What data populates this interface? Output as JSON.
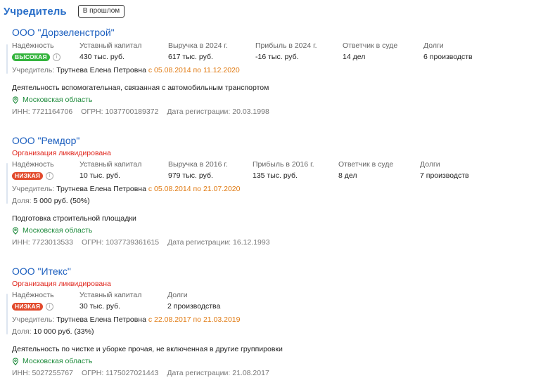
{
  "section": {
    "title": "Учредитель",
    "past_button": "В прошлом"
  },
  "companies": [
    {
      "name": "ООО \"Дорзеленстрой\"",
      "status": "",
      "stats": {
        "reliability_label": "Надёжность",
        "reliability_value": "ВЫСОКАЯ",
        "reliability_color": "#34b43d",
        "capital_label": "Уставный капитал",
        "capital_value": "430 тыс. руб.",
        "revenue_label": "Выручка в 2024 г.",
        "revenue_value": "617 тыс. руб.",
        "profit_label": "Прибыль в 2024 г.",
        "profit_value": "-16 тыс. руб.",
        "court_label": "Ответчик в суде",
        "court_value": "14 дел",
        "debts_label": "Долги",
        "debts_value": "6 производств"
      },
      "founder_label": "Учредитель:",
      "founder_name": "Трутнева Елена Петровна",
      "founder_period": "с 05.08.2014 по 11.12.2020",
      "share_label": "",
      "share_value": "",
      "activity": "Деятельность вспомогательная, связанная с автомобильным транспортом",
      "region": "Московская область",
      "inn": "ИНН: 7721164706",
      "ogrn": "ОГРН: 1037700189372",
      "reg_date": "Дата регистрации: 20.03.1998"
    },
    {
      "name": "ООО \"Ремдор\"",
      "status": "Организация ликвидирована",
      "stats": {
        "reliability_label": "Надёжность",
        "reliability_value": "НИЗКАЯ",
        "reliability_color": "#e24a2c",
        "capital_label": "Уставный капитал",
        "capital_value": "10 тыс. руб.",
        "revenue_label": "Выручка в 2016 г.",
        "revenue_value": "979 тыс. руб.",
        "profit_label": "Прибыль в 2016 г.",
        "profit_value": "135 тыс. руб.",
        "court_label": "Ответчик в суде",
        "court_value": "8 дел",
        "debts_label": "Долги",
        "debts_value": "7 производств"
      },
      "founder_label": "Учредитель:",
      "founder_name": "Трутнева Елена Петровна",
      "founder_period": "с 05.08.2014 по 21.07.2020",
      "share_label": "Доля:",
      "share_value": "5 000 руб. (50%)",
      "activity": "Подготовка строительной площадки",
      "region": "Московская область",
      "inn": "ИНН: 7723013533",
      "ogrn": "ОГРН: 1037739361615",
      "reg_date": "Дата регистрации: 16.12.1993"
    },
    {
      "name": "ООО \"Итекс\"",
      "status": "Организация ликвидирована",
      "stats": {
        "reliability_label": "Надёжность",
        "reliability_value": "НИЗКАЯ",
        "reliability_color": "#e24a2c",
        "capital_label": "Уставный капитал",
        "capital_value": "30 тыс. руб.",
        "debts_label": "Долги",
        "debts_value": "2 производства"
      },
      "founder_label": "Учредитель:",
      "founder_name": "Трутнева Елена Петровна",
      "founder_period": "с 22.08.2017 по 21.03.2019",
      "share_label": "Доля:",
      "share_value": "10 000 руб. (33%)",
      "activity": "Деятельность по чистке и уборке прочая, не включенная в другие группировки",
      "region": "Московская область",
      "inn": "ИНН: 5027255767",
      "ogrn": "ОГРН: 1175027021443",
      "reg_date": "Дата регистрации: 21.08.2017"
    }
  ]
}
